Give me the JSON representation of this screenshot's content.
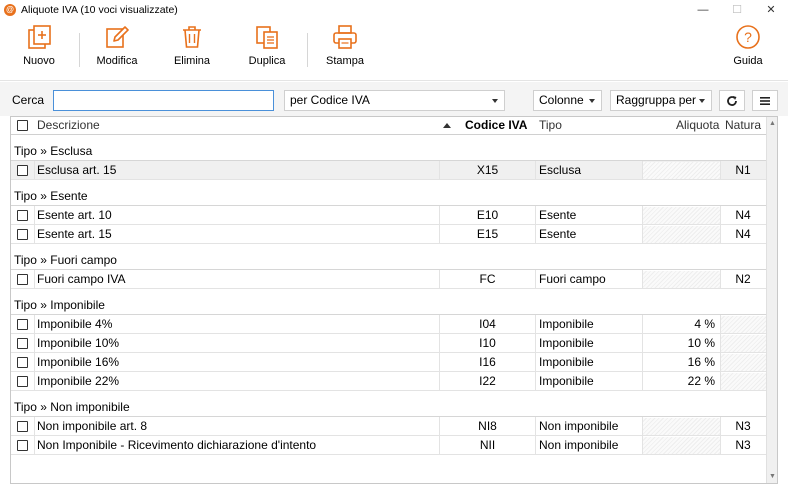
{
  "window": {
    "title": "Aliquote IVA (10 voci visualizzate)",
    "controls": {
      "minimize": "—",
      "maximize": "☐",
      "close": "✕"
    }
  },
  "toolbar": {
    "nuovo": "Nuovo",
    "modifica": "Modifica",
    "elimina": "Elimina",
    "duplica": "Duplica",
    "stampa": "Stampa",
    "guida": "Guida"
  },
  "search": {
    "label": "Cerca",
    "value": "",
    "field_select": "per Codice IVA",
    "colonne": "Colonne",
    "raggruppa": "Raggruppa per"
  },
  "grid": {
    "columns": {
      "descrizione": "Descrizione",
      "codice": "Codice IVA",
      "tipo": "Tipo",
      "aliquota": "Aliquota",
      "natura": "Natura"
    },
    "groups": [
      {
        "label": "Tipo » Esclusa",
        "rows": [
          {
            "descrizione": "Esclusa art. 15",
            "codice": "X15",
            "tipo": "Esclusa",
            "aliquota": "",
            "natura": "N1",
            "selected": true
          }
        ]
      },
      {
        "label": "Tipo » Esente",
        "rows": [
          {
            "descrizione": "Esente art. 10",
            "codice": "E10",
            "tipo": "Esente",
            "aliquota": "",
            "natura": "N4"
          },
          {
            "descrizione": "Esente art. 15",
            "codice": "E15",
            "tipo": "Esente",
            "aliquota": "",
            "natura": "N4"
          }
        ]
      },
      {
        "label": "Tipo » Fuori campo",
        "rows": [
          {
            "descrizione": "Fuori campo IVA",
            "codice": "FC",
            "tipo": "Fuori campo",
            "aliquota": "",
            "natura": "N2"
          }
        ]
      },
      {
        "label": "Tipo » Imponibile",
        "rows": [
          {
            "descrizione": "Imponibile 4%",
            "codice": "I04",
            "tipo": "Imponibile",
            "aliquota": "4 %",
            "natura": ""
          },
          {
            "descrizione": "Imponibile 10%",
            "codice": "I10",
            "tipo": "Imponibile",
            "aliquota": "10 %",
            "natura": ""
          },
          {
            "descrizione": "Imponibile 16%",
            "codice": "I16",
            "tipo": "Imponibile",
            "aliquota": "16 %",
            "natura": ""
          },
          {
            "descrizione": "Imponibile 22%",
            "codice": "I22",
            "tipo": "Imponibile",
            "aliquota": "22 %",
            "natura": ""
          }
        ]
      },
      {
        "label": "Tipo » Non imponibile",
        "rows": [
          {
            "descrizione": "Non imponibile art. 8",
            "codice": "NI8",
            "tipo": "Non imponibile",
            "aliquota": "",
            "natura": "N3"
          },
          {
            "descrizione": "Non Imponibile - Ricevimento dichiarazione d'intento",
            "codice": "NII",
            "tipo": "Non imponibile",
            "aliquota": "",
            "natura": "N3"
          }
        ]
      }
    ]
  },
  "colors": {
    "accent": "#e8711c",
    "focus": "#4a90d9"
  }
}
